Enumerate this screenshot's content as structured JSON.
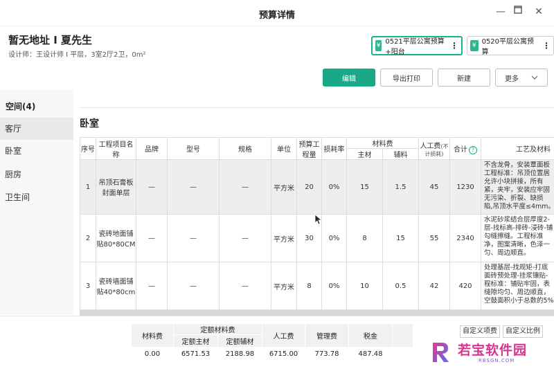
{
  "window": {
    "title": "预算详情"
  },
  "header": {
    "address": "暂无地址 I 夏先生",
    "designer_info": "设计师：王设计师 I 平层，3室2厅2卫，0m²"
  },
  "plans": [
    {
      "label": "0521平层公寓预算+阳台",
      "active": true
    },
    {
      "label": "0520平层公寓预算",
      "active": false
    }
  ],
  "yen_symbol": "¥",
  "more_symbol": "⋮",
  "toolbar": {
    "edit": "编辑",
    "export_print": "导出打印",
    "new": "新建",
    "more": "更多"
  },
  "sidebar": {
    "heading": "空间(4)",
    "items": [
      "客厅",
      "卧室",
      "厨房",
      "卫生间"
    ],
    "active_index": 0
  },
  "room": {
    "title": "卧室"
  },
  "table": {
    "headers": {
      "seq": "序号",
      "name": "工程项目名称",
      "brand": "品牌",
      "model": "型号",
      "spec": "规格",
      "unit": "单位",
      "qty": "预算工程量",
      "loss": "损耗率",
      "material": "材料费",
      "main": "主材",
      "aux": "辅料",
      "labor": "人工费",
      "labor_note": "(不计损耗)",
      "total": "合计",
      "craft": "工艺及材料"
    },
    "help_symbol": "?",
    "rows": [
      {
        "seq": "1",
        "name": "吊顶石膏板封面单层",
        "brand": "—",
        "model": "—",
        "spec": "—",
        "unit": "平方米",
        "qty": "20",
        "loss": "0%",
        "main": "15",
        "aux": "1.5",
        "labor": "45",
        "total": "1230",
        "craft": [
          "不含龙骨，安装覃面板",
          "工程标准：吊顶位置居",
          "允许小块拼接，所有",
          "紧，夹牢，安装应牢固",
          "无污染、折裂、缺损",
          "陷,吊顶水平度≤4mm。"
        ]
      },
      {
        "seq": "2",
        "name": "瓷砖地面铺贴80*80CM",
        "brand": "—",
        "model": "—",
        "spec": "—",
        "unit": "平方米",
        "qty": "30",
        "loss": "0%",
        "main": "8",
        "aux": "15",
        "labor": "55",
        "total": "2340",
        "craft": [
          "水泥砂浆结合层厚度2-",
          "层-找标高-排砖-浸砖-铺",
          "勾缝擦缝。工程标准",
          "净，图案清晰，色泽一",
          "匀、周边顺直。"
        ]
      },
      {
        "seq": "3",
        "name": "瓷砖墙面铺贴40*80cm",
        "brand": "—",
        "model": "—",
        "spec": "—",
        "unit": "平方米",
        "qty": "8",
        "loss": "0%",
        "main": "10",
        "aux": "0.5",
        "labor": "42",
        "total": "420",
        "craft": [
          "处理基层-找规矩-打底",
          "面砖预处理-挂浆镶贴-",
          "程标准：铺贴牢固，表",
          "缝隙均匀、周边顺直，",
          "空鼓面积小于总数的5%"
        ]
      }
    ]
  },
  "summary": {
    "headers": {
      "material_fee": "材料费",
      "quota_material": "定额材料费",
      "quota_main": "定额主材",
      "quota_aux": "定额辅材",
      "labor": "人工费",
      "management": "管理费",
      "tax": "税金"
    },
    "values": {
      "material_fee": "0.00",
      "quota_main": "6571.53",
      "quota_aux": "2188.98",
      "labor": "6715.00",
      "management": "773.78",
      "tax": "487.48"
    },
    "custom_items": "自定义项费",
    "custom_ratio": "自定义比例"
  },
  "watermark": {
    "brand": "若宝软件园",
    "url": "RBSGN.COM"
  }
}
